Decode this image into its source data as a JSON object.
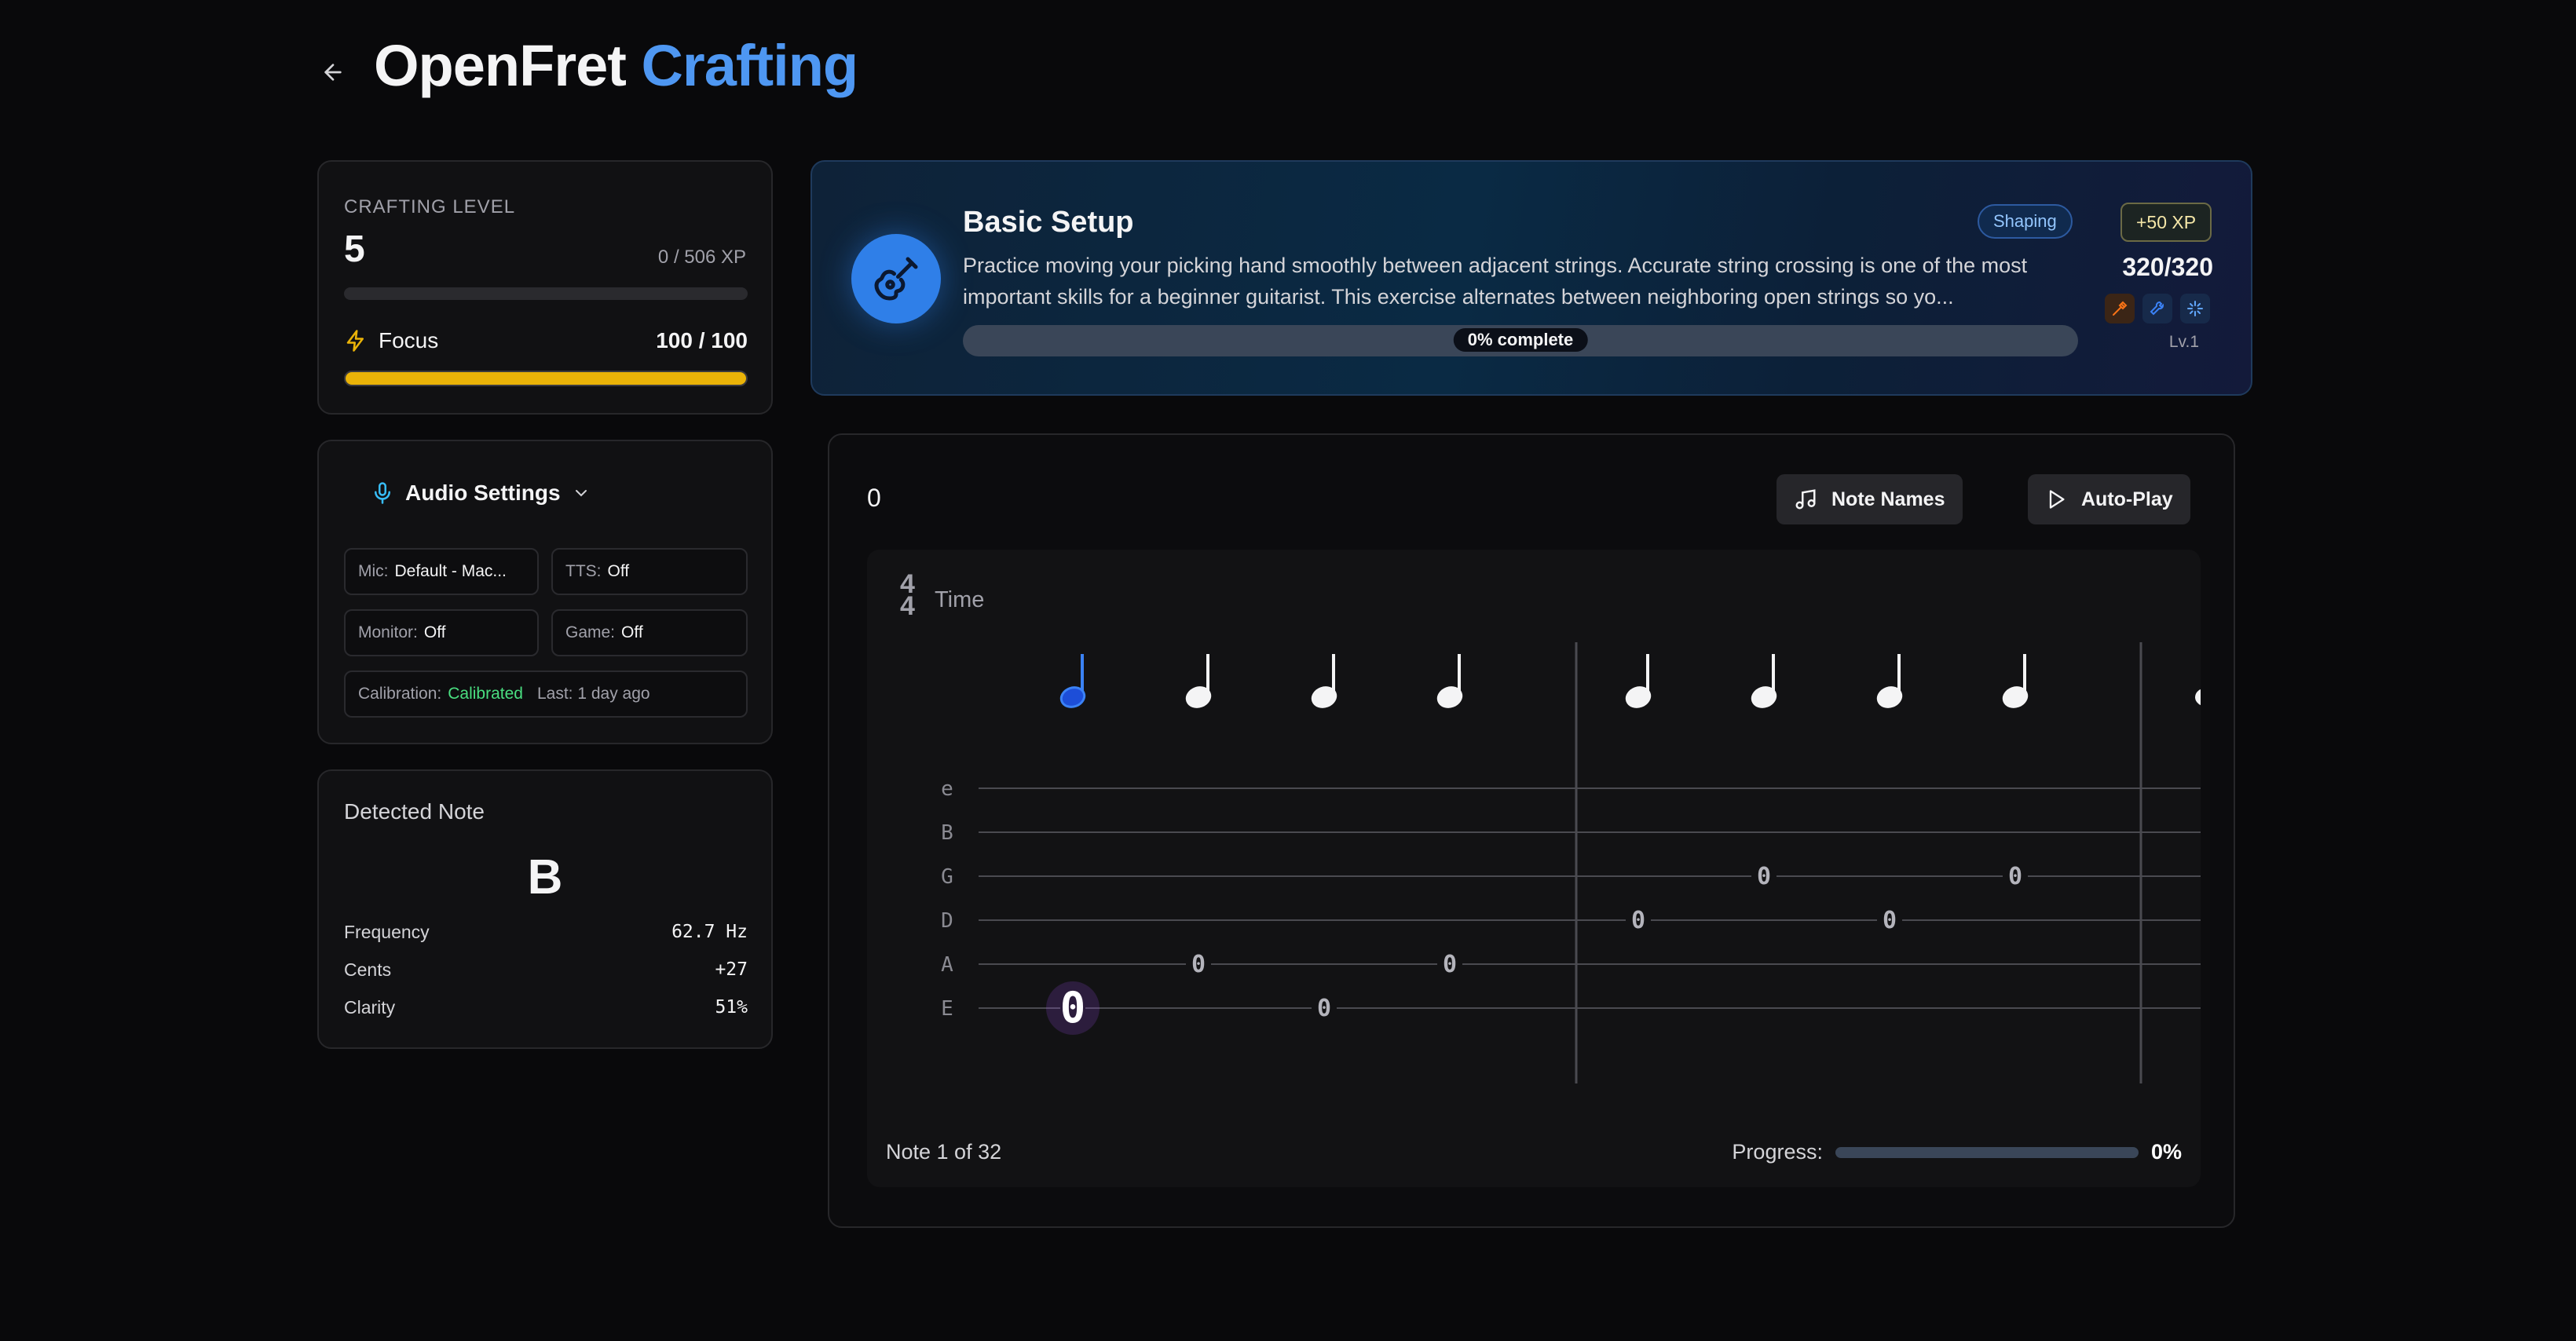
{
  "header": {
    "title_main": "OpenFret",
    "title_accent": "Crafting"
  },
  "crafting": {
    "label": "CRAFTING LEVEL",
    "level": "5",
    "xp": "0 / 506 XP",
    "xp_progress": 0,
    "focus_label": "Focus",
    "focus_value": "100 / 100",
    "focus_progress": 1.0
  },
  "audio": {
    "title": "Audio Settings",
    "mic_label": "Mic:",
    "mic_value": "Default - Mac...",
    "tts_label": "TTS:",
    "tts_value": "Off",
    "monitor_label": "Monitor:",
    "monitor_value": "Off",
    "game_label": "Game:",
    "game_value": "Off",
    "calibration_label": "Calibration:",
    "calibration_value": "Calibrated",
    "last_label": "Last: 1 day ago"
  },
  "detected": {
    "label": "Detected Note",
    "note": "B",
    "stats": [
      {
        "label": "Frequency",
        "value": "62.7 Hz"
      },
      {
        "label": "Cents",
        "value": "+27"
      },
      {
        "label": "Clarity",
        "value": "51%"
      }
    ]
  },
  "exercise": {
    "title": "Basic Setup",
    "description": "Practice moving your picking hand smoothly between adjacent strings. Accurate string crossing is one of the most important skills for a beginner guitarist. This exercise alternates between neighboring open strings so yo...",
    "progress_label": "0% complete",
    "progress": 0,
    "badge": "Shaping",
    "xp_reward": "+50 XP",
    "score": "320/320",
    "level": "Lv.1",
    "colors": {
      "accent": "#2f7fe8",
      "tool_orange": "#f97316",
      "tool_blue": "#3b82f6",
      "tool_sky": "#60a5fa"
    }
  },
  "tab": {
    "count": "0",
    "note_names_label": "Note Names",
    "autoplay_label": "Auto-Play",
    "time_sig_top": "4",
    "time_sig_bottom": "4",
    "time_label": "Time",
    "strings": [
      "e",
      "B",
      "G",
      "D",
      "A",
      "E"
    ],
    "notes": [
      {
        "string": 5,
        "fret": "0",
        "active": true
      },
      {
        "string": 4,
        "fret": "0"
      },
      {
        "string": 5,
        "fret": "0"
      },
      {
        "string": 4,
        "fret": "0"
      },
      {
        "string": 3,
        "fret": "0"
      },
      {
        "string": 2,
        "fret": "0"
      },
      {
        "string": 3,
        "fret": "0"
      },
      {
        "string": 2,
        "fret": "0"
      }
    ],
    "footer_left": "Note 1 of 32",
    "progress_label": "Progress:",
    "progress_value": "0%",
    "progress": 0
  }
}
